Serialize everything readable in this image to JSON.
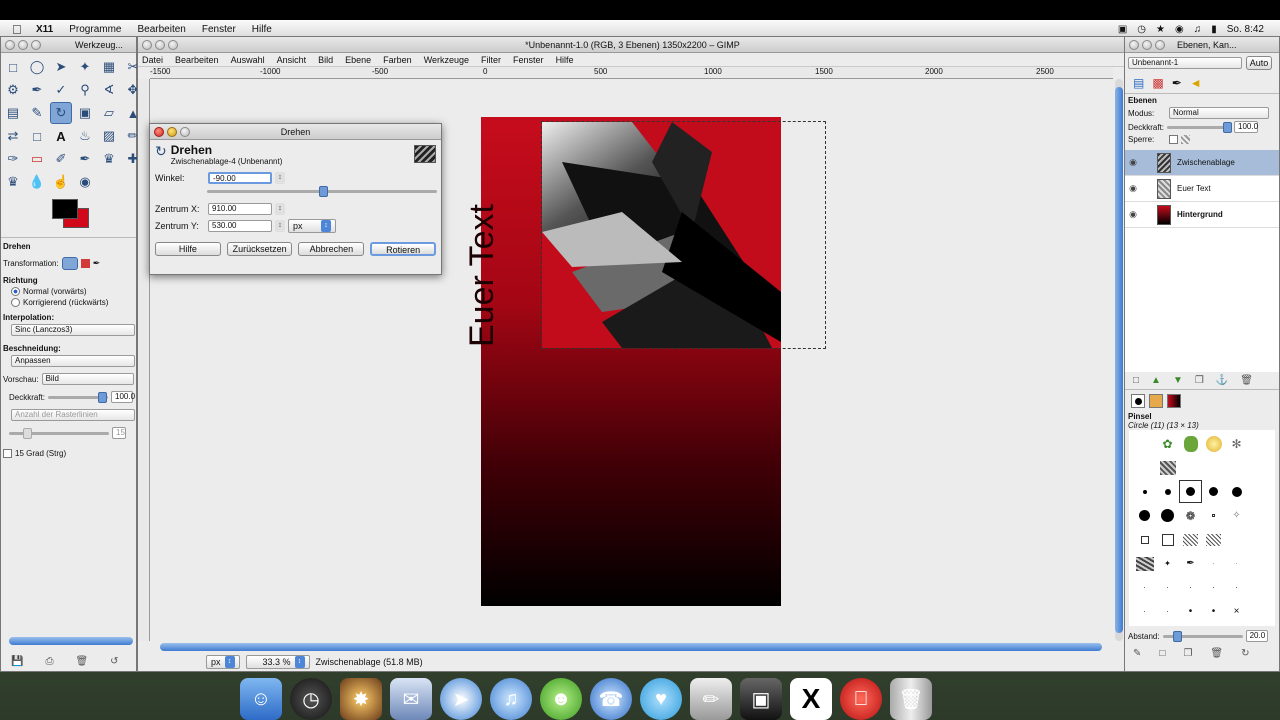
{
  "menubar": {
    "app": "X11",
    "items": [
      "Programme",
      "Bearbeiten",
      "Fenster",
      "Hilfe"
    ],
    "clock": "So. 8:42"
  },
  "toolbox": {
    "title": "Werkzeug...",
    "options_title": "Drehen",
    "transformation_label": "Transformation:",
    "direction_label": "Richtung",
    "direction_normal": "Normal (vorwärts)",
    "direction_corrective": "Korrigierend (rückwärts)",
    "interpolation_label": "Interpolation:",
    "interpolation_value": "Sinc (Lanczos3)",
    "clipping_label": "Beschneidung:",
    "clipping_value": "Anpassen",
    "preview_label": "Vorschau:",
    "preview_value": "Bild",
    "opacity_label": "Deckkraft:",
    "opacity_value": "100.0",
    "grid_placeholder": "Anzahl der Rasterlinien",
    "grid_value": "15",
    "snap_label": "15 Grad (Strg)"
  },
  "image_window": {
    "title": "*Unbenannt-1.0 (RGB, 3 Ebenen) 1350x2200 – GIMP",
    "menu": [
      "Datei",
      "Bearbeiten",
      "Auswahl",
      "Ansicht",
      "Bild",
      "Ebene",
      "Farben",
      "Werkzeuge",
      "Filter",
      "Fenster",
      "Hilfe"
    ],
    "ruler_ticks": [
      "-1500",
      "-1000",
      "-500",
      "0",
      "500",
      "1000",
      "1500",
      "2000",
      "2500"
    ],
    "poster_text": "Euer Text",
    "status_unit": "px",
    "status_zoom": "33.3 %",
    "status_text": "Zwischenablage (51.8 MB)"
  },
  "dialog": {
    "window_title": "Drehen",
    "heading": "Drehen",
    "subheading": "Zwischenablage-4 (Unbenannt)",
    "angle_label": "Winkel:",
    "angle_value": "-90.00",
    "center_x_label": "Zentrum X:",
    "center_x_value": "910.00",
    "center_y_label": "Zentrum Y:",
    "center_y_value": "530.00",
    "unit": "px",
    "buttons": {
      "help": "Hilfe",
      "reset": "Zurücksetzen",
      "cancel": "Abbrechen",
      "rotate": "Rotieren"
    }
  },
  "layers_dock": {
    "title": "Ebenen, Kan...",
    "image_select": "Unbenannt-1",
    "auto_button": "Auto",
    "section": "Ebenen",
    "mode_label": "Modus:",
    "mode_value": "Normal",
    "opacity_label": "Deckkraft:",
    "opacity_value": "100.0",
    "lock_label": "Sperre:",
    "layers": [
      "Zwischenablage",
      "Euer Text",
      "Hintergrund"
    ],
    "brushes_title": "Pinsel",
    "brush_name": "Circle (11) (13 × 13)",
    "spacing_label": "Abstand:",
    "spacing_value": "20.0"
  },
  "colors": {
    "foreground": "#000000",
    "background": "#d2091b",
    "accent": "#3e7bd1"
  }
}
